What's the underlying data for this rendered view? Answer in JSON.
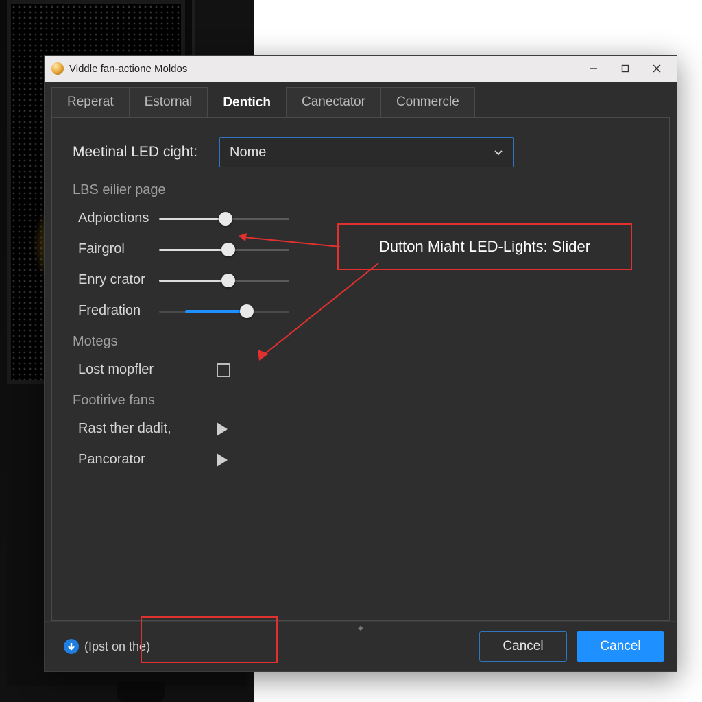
{
  "window": {
    "title": "Viddle fan-actione Moldos"
  },
  "tabs": [
    "Reperat",
    "Estornal",
    "Dentich",
    "Canectator",
    "Conmercle"
  ],
  "active_tab_index": 2,
  "led_mode": {
    "label": "Meetinal LED cight:",
    "selected": "Nome"
  },
  "sliders_section": {
    "title": "LBS eilier page",
    "items": [
      {
        "label": "Adpioctions"
      },
      {
        "label": "Fairgrol"
      },
      {
        "label": "Enry crator"
      },
      {
        "label": "Fredration"
      }
    ]
  },
  "motegs_section": {
    "title": "Motegs",
    "checkbox_label": "Lost mopfler"
  },
  "fans_section": {
    "title": "Footirive fans",
    "items": [
      {
        "label": "Rast ther dadit,"
      },
      {
        "label": "Pancorator"
      }
    ]
  },
  "callout": "Dutton Miaht LED-Lights: Slider",
  "footer": {
    "hint": "(Ipst on the)",
    "cancel": "Cancel",
    "ok": "Cancel"
  }
}
